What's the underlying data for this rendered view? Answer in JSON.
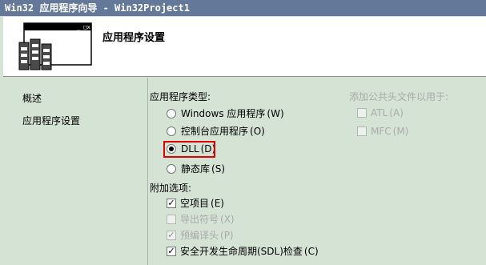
{
  "window": {
    "title": "Win32 应用程序向导 - Win32Project1"
  },
  "header": {
    "title": "应用程序设置",
    "logo_icon": "wizard-window-icon"
  },
  "nav": {
    "items": [
      "概述",
      "应用程序设置"
    ]
  },
  "app_type": {
    "label": "应用程序类型:",
    "options": [
      {
        "text": "Windows 应用程序",
        "key": "(W)",
        "checked": false
      },
      {
        "text": "控制台应用程序",
        "key": "(O)",
        "checked": false
      },
      {
        "text": "DLL",
        "key": "(D)",
        "checked": true
      },
      {
        "text": "静态库",
        "key": "(S)",
        "checked": false
      }
    ]
  },
  "extra": {
    "label": "附加选项:",
    "options": [
      {
        "text": "空项目",
        "key": "(E)",
        "checked": true,
        "enabled": true
      },
      {
        "text": "导出符号",
        "key": "(X)",
        "checked": false,
        "enabled": false
      },
      {
        "text": "预编译头",
        "key": "(P)",
        "checked": true,
        "enabled": false
      },
      {
        "text": "安全开发生命周期(SDL)检查",
        "key": "(C)",
        "checked": true,
        "enabled": true
      }
    ]
  },
  "headers": {
    "label": "添加公共头文件以用于:",
    "options": [
      {
        "text": "ATL",
        "key": "(A)",
        "checked": false,
        "enabled": false
      },
      {
        "text": "MFC",
        "key": "(M)",
        "checked": false,
        "enabled": false
      }
    ]
  },
  "colors": {
    "titlebar": "#64789a",
    "background": "#d4e3d4",
    "highlight": "#e00000"
  }
}
